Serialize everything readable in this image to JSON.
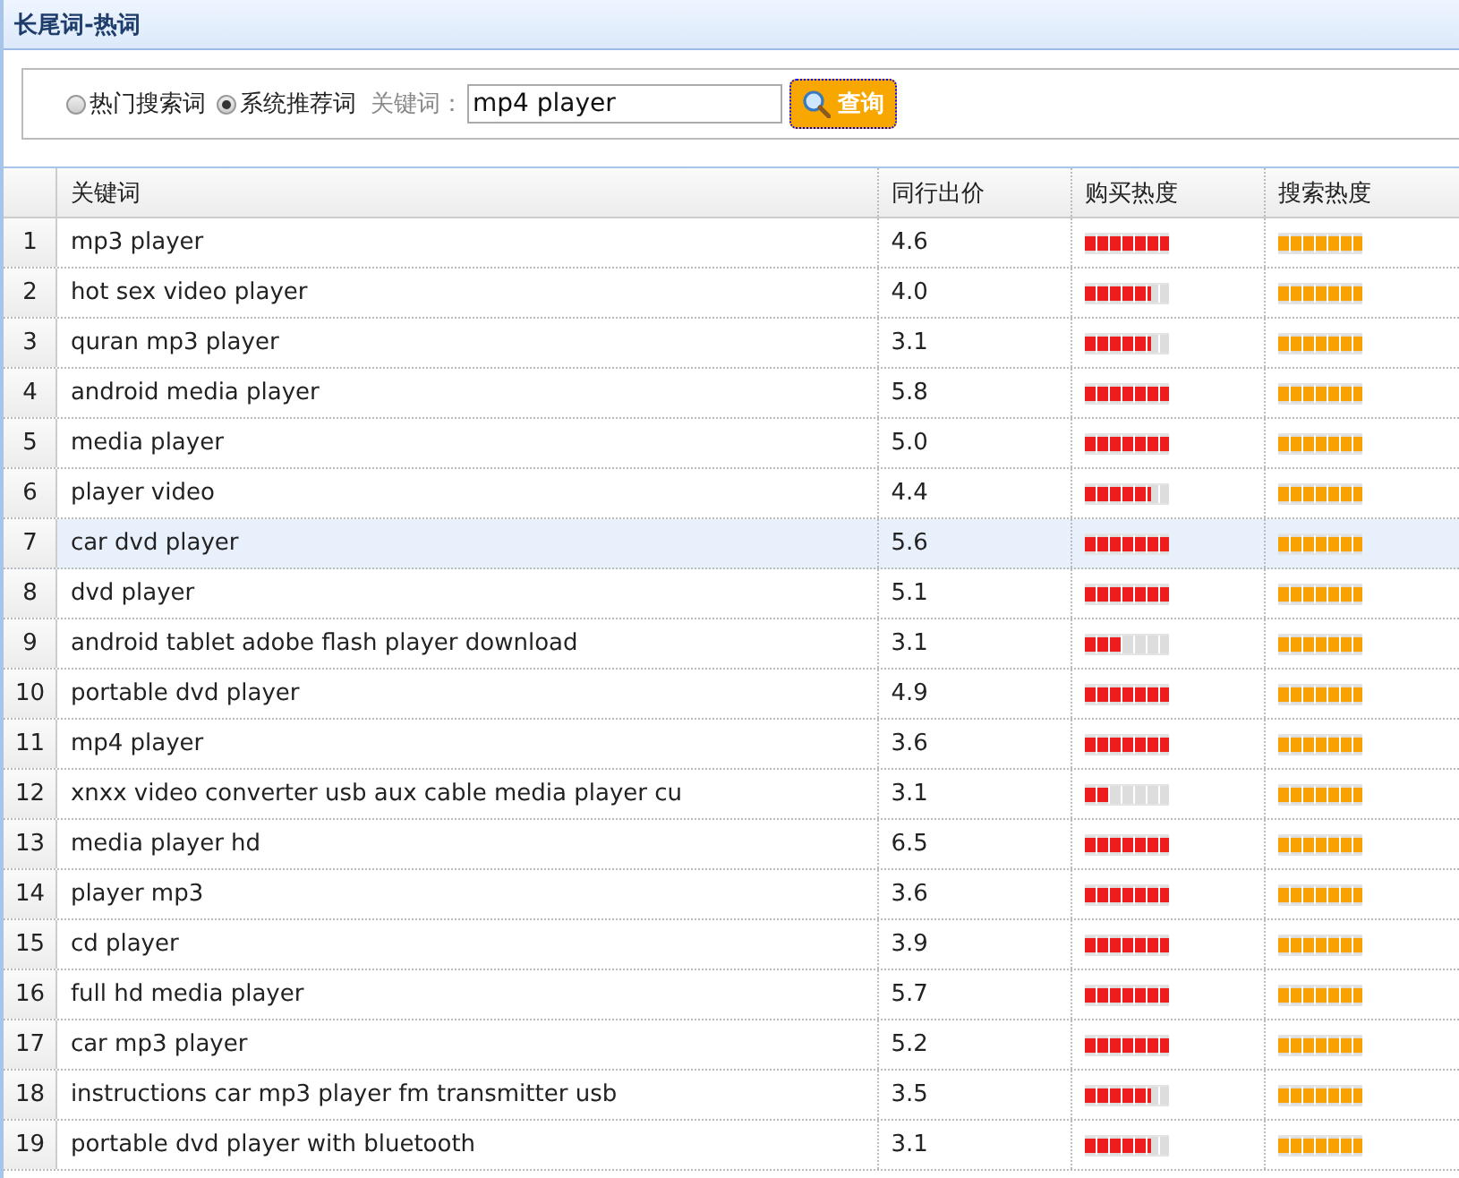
{
  "window": {
    "title": "长尾词-热词"
  },
  "search": {
    "options": [
      {
        "label": "热门搜索词",
        "selected": false
      },
      {
        "label": "系统推荐词",
        "selected": true
      }
    ],
    "keyword_label": "关键词：",
    "value": "mp4 player",
    "button": "查询"
  },
  "table": {
    "columns": [
      "关键词",
      "同行出价",
      "购买热度",
      "搜索热度"
    ],
    "rows": [
      {
        "index": "1",
        "keyword": "mp3 player",
        "bid": "4.6",
        "buy_heat": {
          "level": 1
        },
        "search_heat": {
          "level": 1
        },
        "selected": false
      },
      {
        "index": "2",
        "keyword": "hot sex video player",
        "bid": "4.0",
        "buy_heat": {
          "level": 0.8
        },
        "search_heat": {
          "level": 1
        },
        "selected": false
      },
      {
        "index": "3",
        "keyword": "quran mp3 player",
        "bid": "3.1",
        "buy_heat": {
          "level": 0.8
        },
        "search_heat": {
          "level": 1
        },
        "selected": false
      },
      {
        "index": "4",
        "keyword": "android media player",
        "bid": "5.8",
        "buy_heat": {
          "level": 1
        },
        "search_heat": {
          "level": 1
        },
        "selected": false
      },
      {
        "index": "5",
        "keyword": "media player",
        "bid": "5.0",
        "buy_heat": {
          "level": 1
        },
        "search_heat": {
          "level": 1
        },
        "selected": false
      },
      {
        "index": "6",
        "keyword": "player video",
        "bid": "4.4",
        "buy_heat": {
          "level": 0.8
        },
        "search_heat": {
          "level": 1
        },
        "selected": false
      },
      {
        "index": "7",
        "keyword": "car dvd player",
        "bid": "5.6",
        "buy_heat": {
          "level": 1
        },
        "search_heat": {
          "level": 1
        },
        "selected": true
      },
      {
        "index": "8",
        "keyword": "dvd player",
        "bid": "5.1",
        "buy_heat": {
          "level": 1
        },
        "search_heat": {
          "level": 1
        },
        "selected": false
      },
      {
        "index": "9",
        "keyword": "android tablet adobe flash player download",
        "bid": "3.1",
        "buy_heat": {
          "level": 0.46
        },
        "search_heat": {
          "level": 1
        },
        "selected": false
      },
      {
        "index": "10",
        "keyword": "portable dvd player",
        "bid": "4.9",
        "buy_heat": {
          "level": 1
        },
        "search_heat": {
          "level": 1
        },
        "selected": false
      },
      {
        "index": "11",
        "keyword": "mp4 player",
        "bid": "3.6",
        "buy_heat": {
          "level": 1
        },
        "search_heat": {
          "level": 1
        },
        "selected": false
      },
      {
        "index": "12",
        "keyword": "xnxx video converter usb aux cable media player cu",
        "bid": "3.1",
        "buy_heat": {
          "level": 0.31
        },
        "search_heat": {
          "level": 1
        },
        "selected": false
      },
      {
        "index": "13",
        "keyword": "media player hd",
        "bid": "6.5",
        "buy_heat": {
          "level": 1
        },
        "search_heat": {
          "level": 1
        },
        "selected": false
      },
      {
        "index": "14",
        "keyword": "player mp3",
        "bid": "3.6",
        "buy_heat": {
          "level": 1
        },
        "search_heat": {
          "level": 1
        },
        "selected": false
      },
      {
        "index": "15",
        "keyword": "cd player",
        "bid": "3.9",
        "buy_heat": {
          "level": 1
        },
        "search_heat": {
          "level": 1
        },
        "selected": false
      },
      {
        "index": "16",
        "keyword": "full hd media player",
        "bid": "5.7",
        "buy_heat": {
          "level": 1
        },
        "search_heat": {
          "level": 1
        },
        "selected": false
      },
      {
        "index": "17",
        "keyword": "car mp3 player",
        "bid": "5.2",
        "buy_heat": {
          "level": 1
        },
        "search_heat": {
          "level": 1
        },
        "selected": false
      },
      {
        "index": "18",
        "keyword": "instructions car mp3 player fm transmitter usb",
        "bid": "3.5",
        "buy_heat": {
          "level": 0.8
        },
        "search_heat": {
          "level": 1
        },
        "selected": false
      },
      {
        "index": "19",
        "keyword": "portable dvd player with bluetooth",
        "bid": "3.1",
        "buy_heat": {
          "level": 0.8
        },
        "search_heat": {
          "level": 1
        },
        "selected": false
      }
    ]
  }
}
